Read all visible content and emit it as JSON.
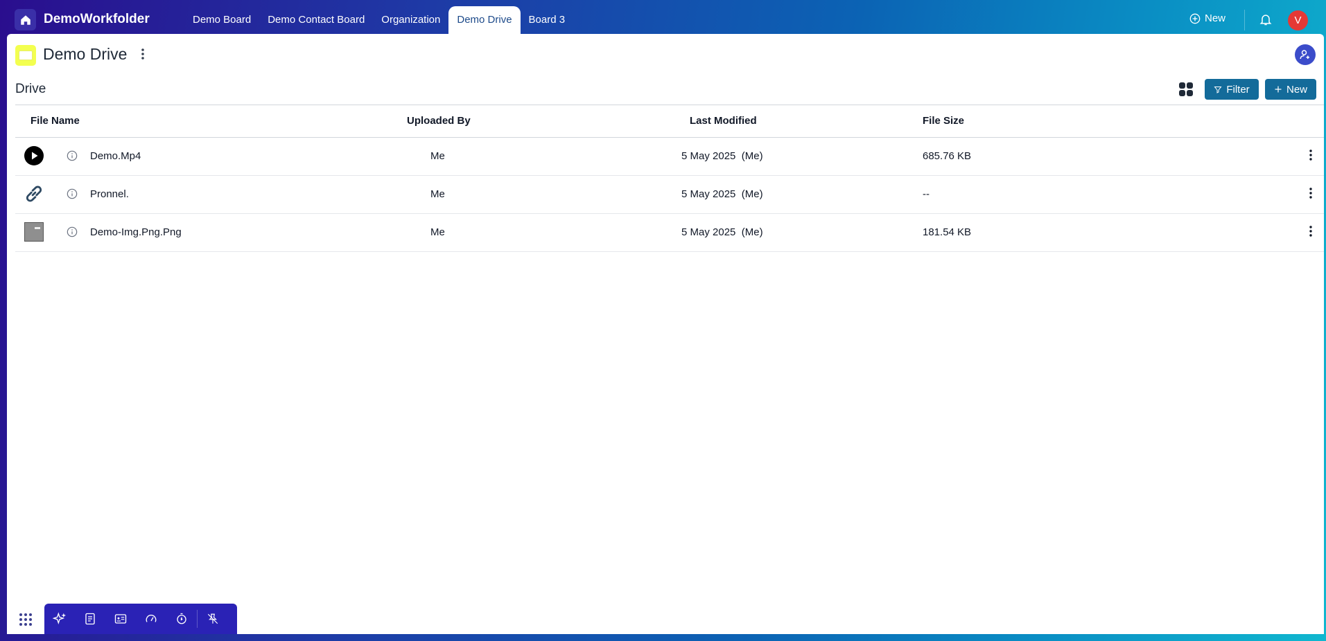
{
  "app": {
    "name": "DemoWorkfolder"
  },
  "nav": {
    "tabs": [
      {
        "label": "Demo Board"
      },
      {
        "label": "Demo Contact Board"
      },
      {
        "label": "Organization"
      },
      {
        "label": "Demo Drive"
      },
      {
        "label": "Board 3"
      }
    ],
    "active_tab": "Demo Drive",
    "new_label": "New",
    "avatar_initial": "V"
  },
  "page": {
    "title": "Demo Drive"
  },
  "drive": {
    "section_title": "Drive",
    "filter_label": "Filter",
    "new_label": "New",
    "columns": {
      "file_name": "File Name",
      "uploaded_by": "Uploaded By",
      "last_modified": "Last Modified",
      "file_size": "File Size"
    },
    "files": [
      {
        "icon": "play-icon",
        "name": "Demo.Mp4",
        "uploaded_by": "Me",
        "modified_date": "5 May 2025",
        "modified_by": "(Me)",
        "size": "685.76 KB"
      },
      {
        "icon": "link-icon",
        "name": "Pronnel.",
        "uploaded_by": "Me",
        "modified_date": "5 May 2025",
        "modified_by": "(Me)",
        "size": "--"
      },
      {
        "icon": "image-icon",
        "name": "Demo-Img.Png.Png",
        "uploaded_by": "Me",
        "modified_date": "5 May 2025",
        "modified_by": "(Me)",
        "size": "181.54 KB"
      }
    ]
  },
  "colors": {
    "accent": "#136b9a",
    "toolbar": "#2a22b5",
    "avatar": "#e53935",
    "page_icon": "#f3ff4f"
  }
}
